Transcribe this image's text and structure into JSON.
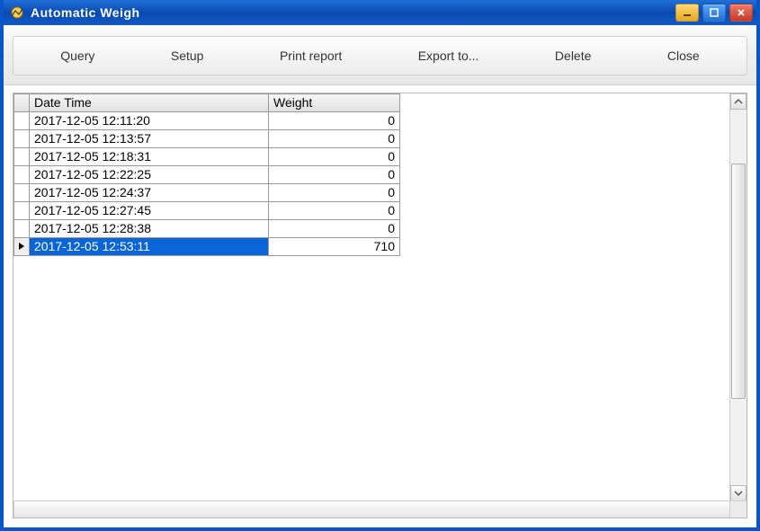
{
  "window": {
    "title": "Automatic Weigh"
  },
  "toolbar": {
    "query": "Query",
    "setup": "Setup",
    "print_report": "Print report",
    "export_to": "Export to...",
    "delete": "Delete",
    "close": "Close"
  },
  "grid": {
    "headers": {
      "datetime": "Date Time",
      "weight": "Weight"
    },
    "rows": [
      {
        "datetime": "2017-12-05 12:11:20",
        "weight": "0",
        "selected": false
      },
      {
        "datetime": "2017-12-05 12:13:57",
        "weight": "0",
        "selected": false
      },
      {
        "datetime": "2017-12-05 12:18:31",
        "weight": "0",
        "selected": false
      },
      {
        "datetime": "2017-12-05 12:22:25",
        "weight": "0",
        "selected": false
      },
      {
        "datetime": "2017-12-05 12:24:37",
        "weight": "0",
        "selected": false
      },
      {
        "datetime": "2017-12-05 12:27:45",
        "weight": "0",
        "selected": false
      },
      {
        "datetime": "2017-12-05 12:28:38",
        "weight": "0",
        "selected": false
      },
      {
        "datetime": "2017-12-05 12:53:11",
        "weight": "710",
        "selected": true
      }
    ]
  }
}
